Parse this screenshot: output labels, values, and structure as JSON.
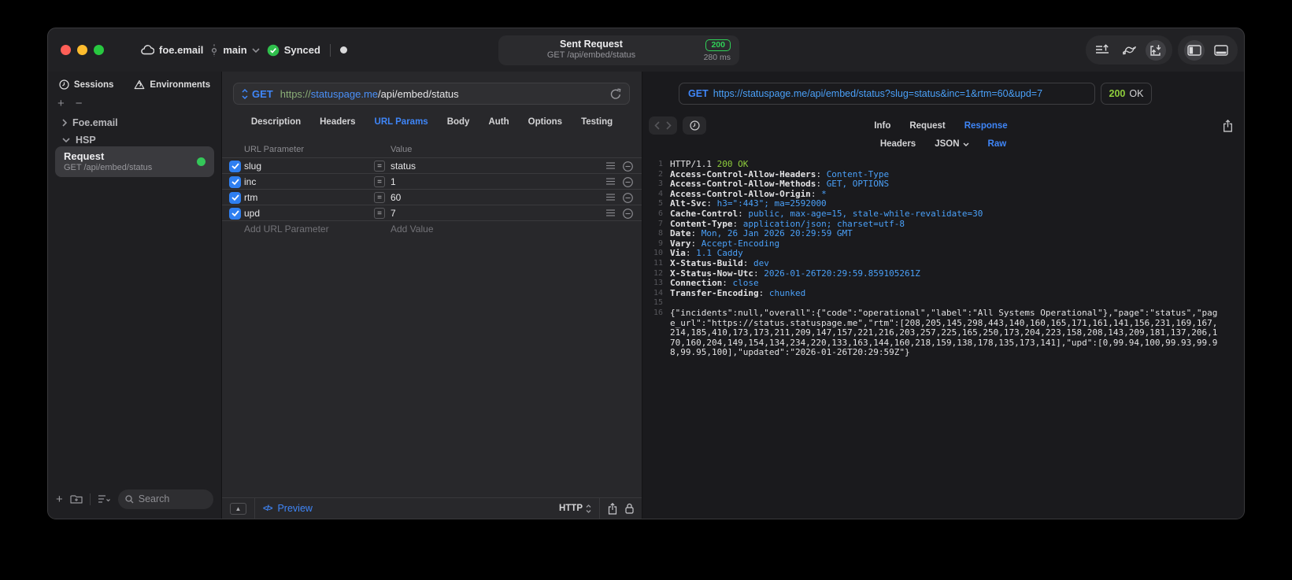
{
  "titlebar": {
    "project": "foe.email",
    "branch": "main",
    "sync": "Synced",
    "center": {
      "title": "Sent Request",
      "subtitle": "GET /api/embed/status",
      "status": "200",
      "duration": "280 ms"
    }
  },
  "sidebar": {
    "tabs": [
      {
        "label": "Sessions"
      },
      {
        "label": "Environments"
      }
    ],
    "tree": [
      {
        "label": "Foe.email"
      },
      {
        "label": "HSP"
      }
    ],
    "request": {
      "title": "Request",
      "subtitle": "GET /api/embed/status"
    },
    "search_placeholder": "Search"
  },
  "request_editor": {
    "method": "GET",
    "url": {
      "scheme": "https://",
      "host": "statuspage.me",
      "path": "/api/embed/status"
    },
    "tabs": [
      "Description",
      "Headers",
      "URL Params",
      "Body",
      "Auth",
      "Options",
      "Testing"
    ],
    "active_tab": "URL Params",
    "params": {
      "col_name": "URL Parameter",
      "col_value": "Value",
      "rows": [
        {
          "name": "slug",
          "value": "status",
          "enabled": true
        },
        {
          "name": "inc",
          "value": "1",
          "enabled": true
        },
        {
          "name": "rtm",
          "value": "60",
          "enabled": true
        },
        {
          "name": "upd",
          "value": "7",
          "enabled": true
        }
      ],
      "add_name": "Add URL Parameter",
      "add_value": "Add Value"
    },
    "footer": {
      "preview": "Preview",
      "code_glyph": "</>",
      "protocol": "HTTP"
    }
  },
  "response_viewer": {
    "method": "GET",
    "url": "https://statuspage.me/api/embed/status?slug=status&inc=1&rtm=60&upd=7",
    "status_code": "200",
    "status_text": "OK",
    "tabs": [
      "Info",
      "Request",
      "Response"
    ],
    "active_tab": "Response",
    "subtabs": [
      "Headers",
      "JSON",
      "Raw"
    ],
    "active_subtab": "Raw",
    "status_line": {
      "protocol": "HTTP/1.1",
      "status": "200 OK"
    },
    "headers": [
      {
        "name": "Access-Control-Allow-Headers",
        "value": "Content-Type"
      },
      {
        "name": "Access-Control-Allow-Methods",
        "value": "GET, OPTIONS"
      },
      {
        "name": "Access-Control-Allow-Origin",
        "value": "*"
      },
      {
        "name": "Alt-Svc",
        "value": "h3=\":443\"; ma=2592000"
      },
      {
        "name": "Cache-Control",
        "value": "public, max-age=15, stale-while-revalidate=30"
      },
      {
        "name": "Content-Type",
        "value": "application/json; charset=utf-8"
      },
      {
        "name": "Date",
        "value": "Mon, 26 Jan 2026 20:29:59 GMT"
      },
      {
        "name": "Vary",
        "value": "Accept-Encoding"
      },
      {
        "name": "Via",
        "value": "1.1 Caddy"
      },
      {
        "name": "X-Status-Build",
        "value": "dev"
      },
      {
        "name": "X-Status-Now-Utc",
        "value": "2026-01-26T20:29:59.859105261Z"
      },
      {
        "name": "Connection",
        "value": "close"
      },
      {
        "name": "Transfer-Encoding",
        "value": "chunked"
      }
    ],
    "body": "{\"incidents\":null,\"overall\":{\"code\":\"operational\",\"label\":\"All Systems Operational\"},\"page\":\"status\",\"page_url\":\"https://status.statuspage.me\",\"rtm\":[208,205,145,298,443,140,160,165,171,161,141,156,231,169,167,214,185,410,173,173,211,209,147,157,221,216,203,257,225,165,250,173,204,223,158,208,143,209,181,137,206,170,160,204,149,154,134,234,220,133,163,144,160,218,159,138,178,135,173,141],\"upd\":[0,99.94,100,99.93,99.98,99.95,100],\"updated\":\"2026-01-26T20:29:59Z\"}"
  },
  "colors": {
    "accent_blue": "#3f86f8",
    "status_green": "#30d158",
    "code_green": "#8fce3c",
    "code_value_blue": "#4aa0f8",
    "traffic_red": "#ff5f57",
    "traffic_yellow": "#febc2e",
    "traffic_green": "#28c840"
  }
}
